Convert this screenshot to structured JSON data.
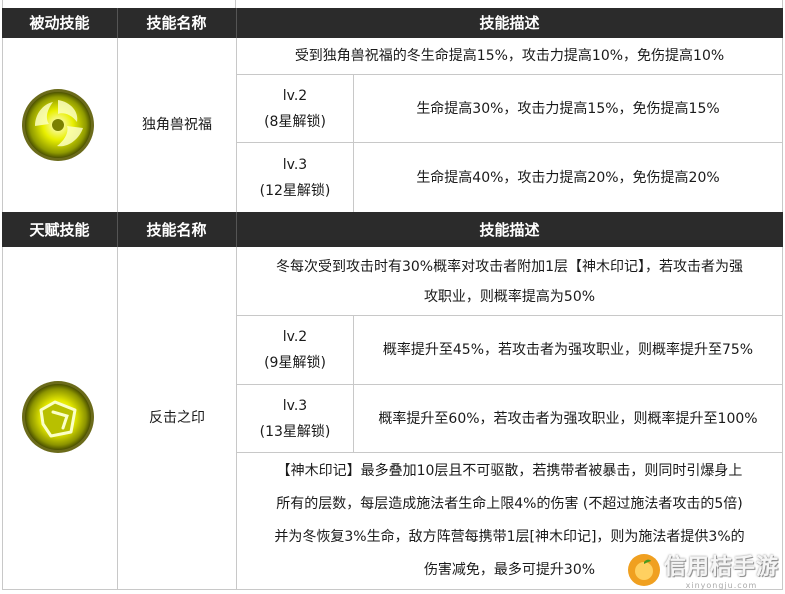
{
  "passive": {
    "header": {
      "col1": "被动技能",
      "col2": "技能名称",
      "col3": "技能描述"
    },
    "skill_name": "独角兽祝福",
    "base_desc": "受到独角兽祝福的冬生命提高15%，攻击力提高10%，免伤提高10%",
    "levels": [
      {
        "lv": "lv.2",
        "unlock": "(8星解锁)",
        "desc": "生命提高30%，攻击力提高15%，免伤提高15%"
      },
      {
        "lv": "lv.3",
        "unlock": "(12星解锁)",
        "desc": "生命提高40%，攻击力提高20%，免伤提高20%"
      }
    ]
  },
  "talent": {
    "header": {
      "col1": "天赋技能",
      "col2": "技能名称",
      "col3": "技能描述"
    },
    "skill_name": "反击之印",
    "base_desc_1": "冬每次受到攻击时有30%概率对攻击者附加1层【神木印记】，若攻击者为强",
    "base_desc_2": "攻职业，则概率提高为50%",
    "levels": [
      {
        "lv": "lv.2",
        "unlock": "(9星解锁)",
        "desc": "概率提升至45%，若攻击者为强攻职业，则概率提升至75%"
      },
      {
        "lv": "lv.3",
        "unlock": "(13星解锁)",
        "desc": "概率提升至60%，若攻击者为强攻职业，则概率提升至100%"
      }
    ],
    "note_lines": [
      "【神木印记】最多叠加10层且不可驱散，若携带者被暴击，则同时引爆身上",
      "所有的层数，每层造成施法者生命上限4%的伤害 (不超过施法者攻击的5倍)",
      "并为冬恢复3%生命，敌方阵营每携带1层[神木印记]，则为施法者提供3%的",
      "伤害减免，最多可提升30%"
    ]
  },
  "watermark": {
    "title": "信用桔手游",
    "url": "xinyongju.com"
  },
  "colors": {
    "header_bg": "#2b2b2b",
    "header_text": "#ffffff",
    "icon_yellow": "#d8e000"
  }
}
